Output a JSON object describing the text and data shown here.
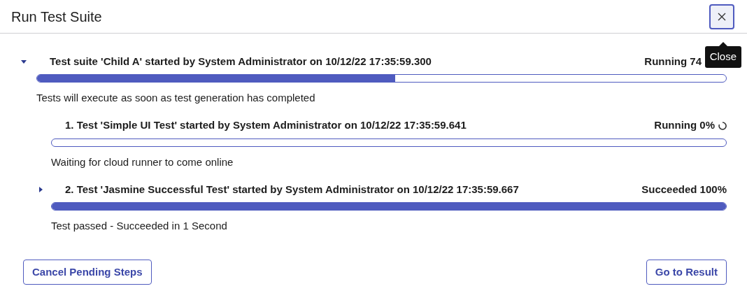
{
  "dialog": {
    "title": "Run Test Suite",
    "close_tooltip": "Close"
  },
  "suite": {
    "expanded": true,
    "heading": "Test suite 'Child A' started by System Administrator on 10/12/22 17:35:59.300",
    "status": "Running 74",
    "level": 0.52,
    "message": "Tests will execute as soon as test generation has completed"
  },
  "tests": [
    {
      "heading": "1. Test 'Simple UI Test' started by System Administrator on 10/12/22 17:35:59.641",
      "status": "Running 0%",
      "spinner": true,
      "level": 0,
      "message": "Waiting for cloud runner to come online"
    },
    {
      "expanded": false,
      "heading": "2. Test 'Jasmine Successful Test' started by System Administrator on 10/12/22 17:35:59.667",
      "status": "Succeeded 100%",
      "spinner": false,
      "level": 1,
      "message": "Test passed - Succeeded in 1 Second"
    }
  ],
  "buttons": {
    "cancel": "Cancel Pending Steps",
    "result": "Go to Result"
  }
}
